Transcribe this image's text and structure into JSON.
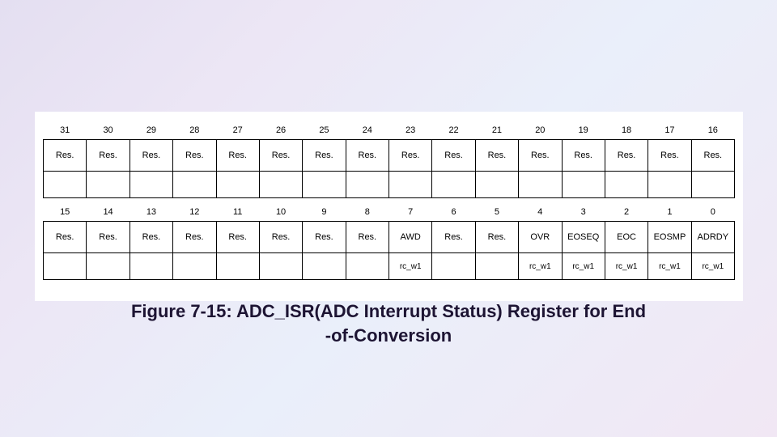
{
  "chart_data": {
    "type": "table",
    "title": "Figure 7-15: ADC_ISR(ADC Interrupt Status) Register for End -of-Conversion",
    "bit_rows": [
      {
        "bits": [
          "31",
          "30",
          "29",
          "28",
          "27",
          "26",
          "25",
          "24",
          "23",
          "22",
          "21",
          "20",
          "19",
          "18",
          "17",
          "16"
        ],
        "fields": [
          "Res.",
          "Res.",
          "Res.",
          "Res.",
          "Res.",
          "Res.",
          "Res.",
          "Res.",
          "Res.",
          "Res.",
          "Res.",
          "Res.",
          "Res.",
          "Res.",
          "Res.",
          "Res."
        ],
        "access": [
          "",
          "",
          "",
          "",
          "",
          "",
          "",
          "",
          "",
          "",
          "",
          "",
          "",
          "",
          "",
          ""
        ]
      },
      {
        "bits": [
          "15",
          "14",
          "13",
          "12",
          "11",
          "10",
          "9",
          "8",
          "7",
          "6",
          "5",
          "4",
          "3",
          "2",
          "1",
          "0"
        ],
        "fields": [
          "Res.",
          "Res.",
          "Res.",
          "Res.",
          "Res.",
          "Res.",
          "Res.",
          "Res.",
          "AWD",
          "Res.",
          "Res.",
          "OVR",
          "EOSEQ",
          "EOC",
          "EOSMP",
          "ADRDY"
        ],
        "access": [
          "",
          "",
          "",
          "",
          "",
          "",
          "",
          "",
          "rc_w1",
          "",
          "",
          "rc_w1",
          "rc_w1",
          "rc_w1",
          "rc_w1",
          "rc_w1"
        ]
      }
    ]
  },
  "caption_line1": "Figure 7-15: ADC_ISR(ADC Interrupt Status) Register for End",
  "caption_line2": "-of-Conversion"
}
